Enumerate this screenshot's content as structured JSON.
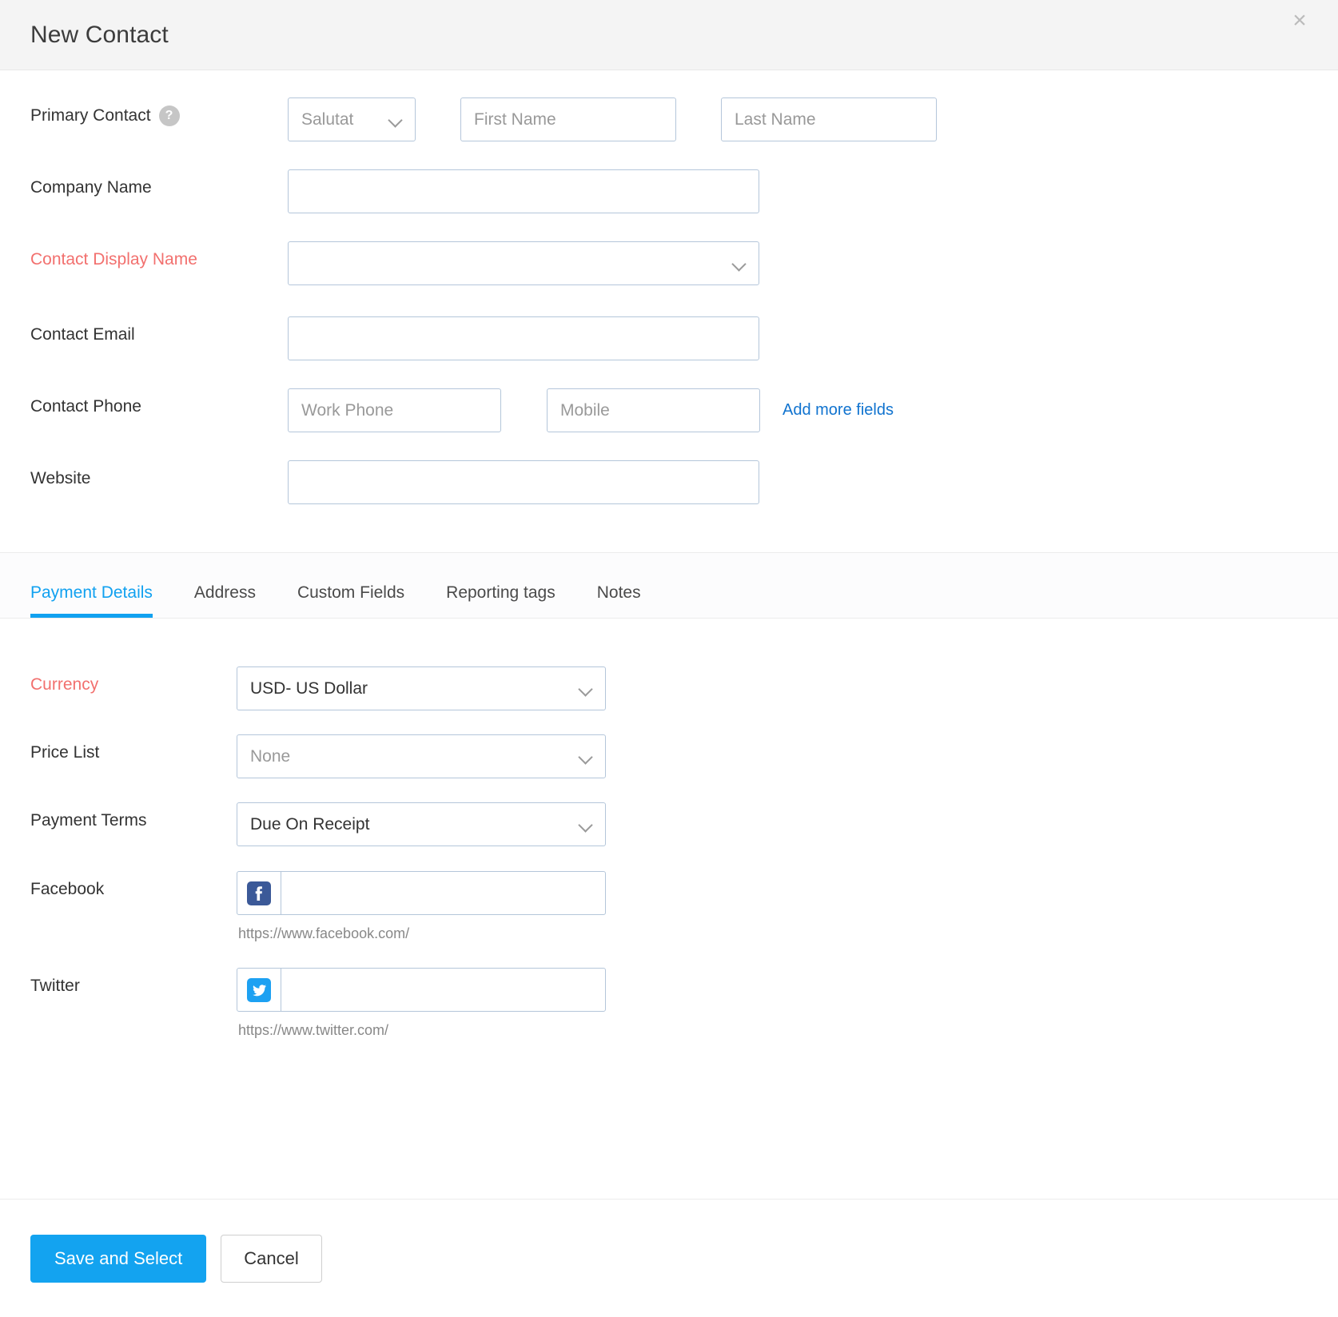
{
  "header": {
    "title": "New Contact",
    "close_label": "×"
  },
  "primary_form": {
    "primary_contact": {
      "label": "Primary Contact",
      "help_glyph": "?",
      "salutation_value": "Salutat",
      "first_name_placeholder": "First Name",
      "first_name_value": "",
      "last_name_placeholder": "Last Name",
      "last_name_value": ""
    },
    "company_name": {
      "label": "Company Name",
      "value": "",
      "placeholder": ""
    },
    "contact_display_name": {
      "label": "Contact Display Name",
      "value": "",
      "required": true
    },
    "contact_email": {
      "label": "Contact Email",
      "value": "",
      "placeholder": ""
    },
    "contact_phone": {
      "label": "Contact Phone",
      "work_phone_placeholder": "Work Phone",
      "work_phone_value": "",
      "mobile_placeholder": "Mobile",
      "mobile_value": "",
      "add_more_fields_label": "Add more fields"
    },
    "website": {
      "label": "Website",
      "value": "",
      "placeholder": ""
    }
  },
  "tabs": [
    {
      "label": "Payment Details",
      "active": true
    },
    {
      "label": "Address",
      "active": false
    },
    {
      "label": "Custom Fields",
      "active": false
    },
    {
      "label": "Reporting tags",
      "active": false
    },
    {
      "label": "Notes",
      "active": false
    }
  ],
  "payment_details": {
    "currency": {
      "label": "Currency",
      "value": "USD- US Dollar",
      "required": true
    },
    "price_list": {
      "label": "Price List",
      "value": "None",
      "muted": true
    },
    "payment_terms": {
      "label": "Payment Terms",
      "value": "Due On Receipt"
    },
    "facebook": {
      "label": "Facebook",
      "icon": "facebook-icon",
      "value": "",
      "placeholder": "",
      "hint": "https://www.facebook.com/"
    },
    "twitter": {
      "label": "Twitter",
      "icon": "twitter-icon",
      "value": "",
      "placeholder": "",
      "hint": "https://www.twitter.com/"
    }
  },
  "footer": {
    "save_label": "Save and Select",
    "cancel_label": "Cancel"
  },
  "colors": {
    "accent": "#13a3f0",
    "required": "#f2706e",
    "link": "#1073cf",
    "facebook": "#3b5998",
    "twitter": "#1da1f2",
    "border": "#b4c6da",
    "header_bg": "#f4f4f4"
  }
}
